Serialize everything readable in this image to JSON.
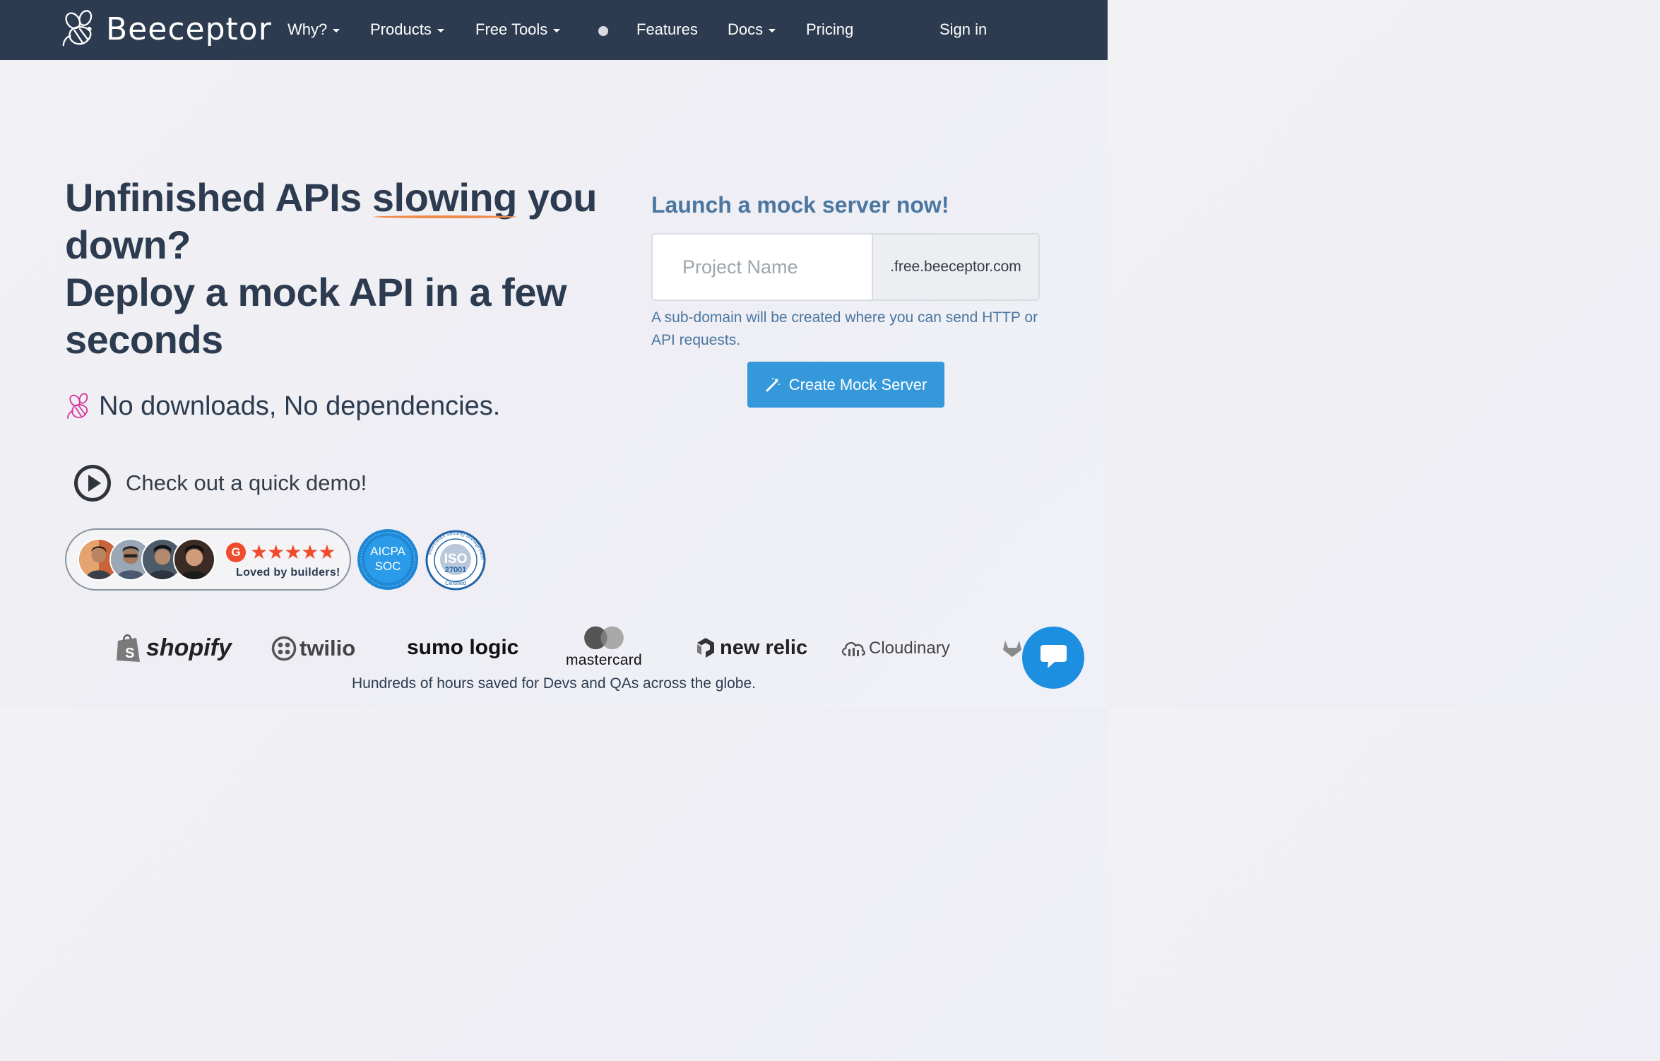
{
  "nav": {
    "brand": "Beeceptor",
    "items": [
      {
        "label": "Why?",
        "dropdown": true
      },
      {
        "label": "Products",
        "dropdown": true
      },
      {
        "label": "Free Tools",
        "dropdown": true
      },
      {
        "label": "Features",
        "dropdown": false
      },
      {
        "label": "Docs",
        "dropdown": true
      },
      {
        "label": "Pricing",
        "dropdown": false
      }
    ],
    "signin": "Sign in"
  },
  "hero": {
    "title_part1": "Unfinished APIs ",
    "title_emphasis": "slowing",
    "title_part2": " you down?",
    "title_line2": "Deploy a mock API in a few seconds",
    "subline": "No downloads, No dependencies.",
    "demo": "Check out a quick demo!"
  },
  "proof": {
    "rating_stars": 5,
    "stars_glyphs": "★★★★★",
    "g2_badge": "G",
    "loved": "Loved by builders!",
    "aicpa_line1": "AICPA",
    "aicpa_line2": "SOC",
    "iso_label": "ISO",
    "iso_number": "27001",
    "iso_ring_text": "Information Security Management",
    "iso_certified": "Certified"
  },
  "launch": {
    "title": "Launch a mock server now!",
    "input_placeholder": "Project Name",
    "input_value": "",
    "domain_suffix": ".free.beeceptor.com",
    "helper": "A sub-domain will be created where you can send HTTP or API requests.",
    "button": "Create Mock Server"
  },
  "logos": {
    "shopify": "shopify",
    "twilio": "twilio",
    "sumo": "sumo logic",
    "mastercard": "mastercard",
    "newrelic": "new relic",
    "cloudinary": "Cloudinary"
  },
  "tagline": "Hundreds of hours saved for Devs and QAs across the globe.",
  "colors": {
    "nav_bg": "#2c3b4f",
    "accent_blue": "#3498db",
    "link_blue": "#4a76a0",
    "underline_orange": "#f08a4b",
    "g2_red": "#f04b2c",
    "chat_blue": "#1d8fe1"
  },
  "icons": {
    "brand": "bee-logo-icon",
    "subline": "bee-icon",
    "demo": "play-circle-icon",
    "button": "magic-wand-icon",
    "chat": "chat-bubble-icon"
  }
}
